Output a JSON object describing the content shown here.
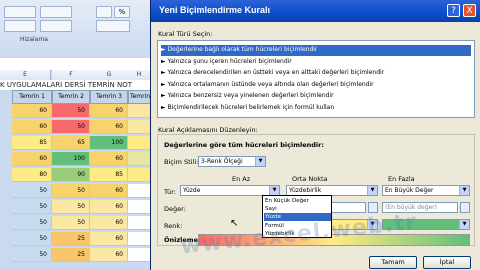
{
  "sheet": {
    "ribbon_label": "Hizalama",
    "percent_icon": "%",
    "columns": [
      "E",
      "F",
      "G",
      "H"
    ],
    "title": "K UYGULAMALARI DERSİ TEMRİN NOT",
    "headers": [
      "Temrin 1",
      "Temrin 2",
      "Temrin 3",
      "Temrin"
    ],
    "rows": [
      [
        "60",
        "50",
        "60",
        ""
      ],
      [
        "60",
        "50",
        "60",
        ""
      ],
      [
        "85",
        "65",
        "100",
        ""
      ],
      [
        "60",
        "100",
        "60",
        ""
      ],
      [
        "80",
        "90",
        "85",
        ""
      ],
      [
        "50",
        "50",
        "60",
        ""
      ],
      [
        "50",
        "50",
        "60",
        ""
      ],
      [
        "50",
        "50",
        "60",
        ""
      ],
      [
        "50",
        "25",
        "60",
        ""
      ],
      [
        "50",
        "25",
        "60",
        ""
      ]
    ],
    "row_colors": [
      [
        "#f8d36b",
        "#f8696b",
        "#f8d36b",
        "#fbe6a2"
      ],
      [
        "#f8d36b",
        "#f8696b",
        "#f8d36b",
        "#fbe6a2"
      ],
      [
        "#ffeb84",
        "#f8d36b",
        "#63be7b",
        "#ffeb84"
      ],
      [
        "#f8d36b",
        "#63be7b",
        "#f8d36b",
        "#e8e5a0"
      ],
      [
        "#ffeb84",
        "#9acd7a",
        "#ffeb84",
        "#ffeb84"
      ],
      [
        "#c8dcf0",
        "#f8d36b",
        "#f8d36b",
        "#ffffff"
      ],
      [
        "#c8dcf0",
        "#fbe6a2",
        "#fbe6a2",
        "#ffffff"
      ],
      [
        "#c8dcf0",
        "#fbe6a2",
        "#fbe6a2",
        "#ffffff"
      ],
      [
        "#c8dcf0",
        "#f8c56b",
        "#fbe6a2",
        "#ffffff"
      ],
      [
        "#c8dcf0",
        "#f8c56b",
        "#fbe6a2",
        "#ffffff"
      ]
    ]
  },
  "dialog": {
    "title": "Yeni Biçimlendirme Kuralı",
    "controls": {
      "help": "?",
      "close": "X"
    },
    "rule_type_label": "Kural Türü Seçin:",
    "rule_types": [
      "Değerlerine bağlı olarak tüm hücreleri biçimlendir",
      "Yalnızca şunu içeren hücreleri biçimlendir",
      "Yalnızca derecelendirilen en üstteki veya en alttaki değerleri biçimlendir",
      "Yalnızca ortalamanın üstünde veya altında olan değerleri biçimlendir",
      "Yalnızca benzersiz veya yinelenen değerleri biçimlendir",
      "Biçimlendirilecek hücreleri belirlemek için formül kullan"
    ],
    "rule_desc_label": "Kural Açıklamasını Düzenleyin:",
    "section_heading": "Değerlerine göre tüm hücreleri biçimlendir:",
    "format_style_label": "Biçim Stili:",
    "format_style_value": "3-Renk Ölçeği",
    "min_heading": "En Az",
    "mid_heading": "Orta Nokta",
    "max_heading": "En Fazla",
    "type_label": "Tür:",
    "value_label": "Değer:",
    "color_label": "Renk:",
    "min_type": "Yüzde",
    "mid_type": "Yüzdebirlik",
    "max_type": "En Büyük Değer",
    "mid_value": "50",
    "max_value_placeholder": "(En büyük değer)",
    "preview_label": "Önizleme:",
    "ok_button": "Tamam",
    "cancel_button": "İptal",
    "dropdown_options": [
      "En Küçük Değer",
      "Sayı",
      "Yüzde",
      "Formül",
      "Yüzdebirlik"
    ],
    "colors": {
      "min": "#f8696b",
      "mid": "#ffeb84",
      "max": "#63be7b"
    }
  },
  "watermark": "www.excel.web.tr"
}
